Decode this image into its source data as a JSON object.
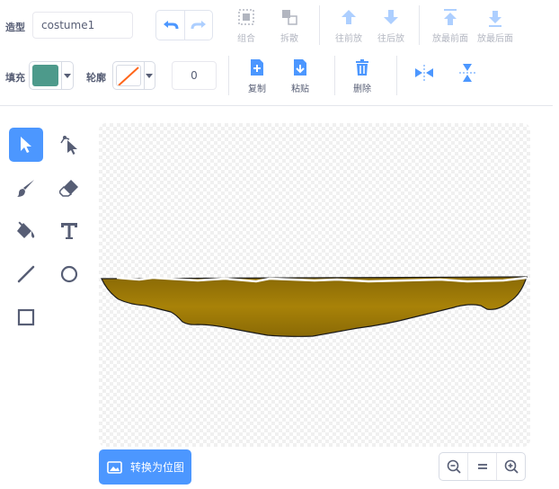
{
  "header": {
    "costume_label": "造型",
    "costume_name": "costume1"
  },
  "toolbar_top": {
    "group": "组合",
    "ungroup": "拆散",
    "forward": "往前放",
    "backward": "往后放",
    "front": "放最前面",
    "back": "放最后面"
  },
  "toolbar_bottom": {
    "fill_label": "填充",
    "outline_label": "轮廓",
    "outline_width": "0",
    "copy": "复制",
    "paste": "粘贴",
    "delete": "删除"
  },
  "colors": {
    "fill": "#4d9a8b",
    "accent": "#4c97ff",
    "shape_fill": "#9b7708",
    "shape_outline": "#1a1a1a"
  },
  "tools": [
    "select-icon",
    "reshape-icon",
    "brush-icon",
    "eraser-icon",
    "fill-icon",
    "text-icon",
    "line-icon",
    "circle-icon",
    "rectangle-icon"
  ],
  "footer": {
    "convert_bitmap": "转换为位图"
  }
}
